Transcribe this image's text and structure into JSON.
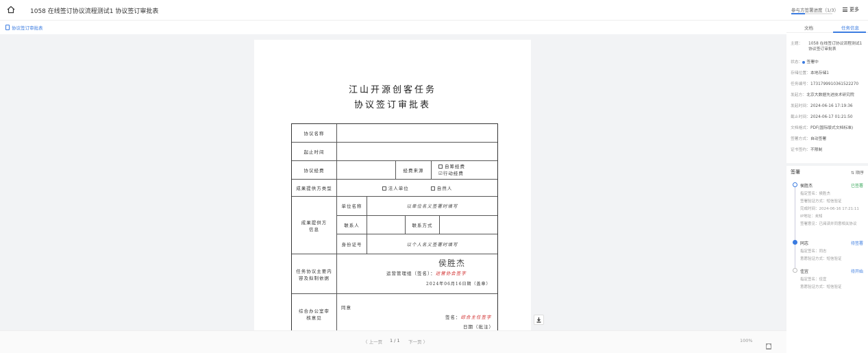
{
  "header": {
    "title": "1058 在线签订协议流程测试1 协议签订审批表",
    "sign_status": "参与方签署进度（1/3）",
    "sign_progress": 0.33,
    "more_label": "更多"
  },
  "doc_tab": {
    "label": "协议签订审批表"
  },
  "document": {
    "title_line1": "江山开源创客任务",
    "title_line2": "协议签订审批表",
    "rows": {
      "agreement_name": "协议名称",
      "period": "起止时间",
      "funds": "协议经费",
      "funds_source": "经费来源",
      "self_funds": "自筹经费",
      "action_funds": "行动经费",
      "provider_type": "成果提供方类型",
      "legal_entity": "法人单位",
      "natural_person": "自然人",
      "provider_info": "成果提供方信息",
      "unit_name": "单位名称",
      "unit_name_hint": "以单位名义签署时填写",
      "contact": "联系人",
      "contact_method": "联系方式",
      "id_number": "身份证号",
      "id_hint": "以个人名义签署时填写",
      "main_content": "任务协议主要内容及拟制依据",
      "manager_sign": "运营管理组（签名）：",
      "manager_sign_red": "运营协会签字",
      "manager_hand": "侯胜杰",
      "manager_date": "2024年06月16日期（盖章）",
      "office_opinion": "综合办公室审核意见",
      "agree": "同意",
      "sign_label": "签名：",
      "sign_red": "综合主任签字",
      "date_label": "日期（批注）"
    }
  },
  "pager": {
    "prev": "〈 上一页",
    "page": "1 / 1",
    "next": "下一页 〉",
    "zoom": "100%"
  },
  "side_tabs": {
    "file": "文档",
    "task": "任务信息"
  },
  "info": {
    "topic_k": "主题：",
    "topic_v": "1058 在线签订协议流程测试1 协议签订审批表",
    "status_k": "状态：",
    "status_v": "签署中",
    "storage_k": "存储位置：",
    "storage_v": "本地存储1",
    "code_k": "任务编号：",
    "code_v": "1731799910361522270",
    "sender_k": "发起方：",
    "sender_v": "北京大数据先进技术研究院",
    "start_k": "发起时间：",
    "start_v": "2024-06-16 17:19:36",
    "deadline_k": "截止时间：",
    "deadline_v": "2024-06-17 01:21:50",
    "format_k": "文档格式：",
    "format_v": "PDF(国际版式文档标准)",
    "sign_mode_k": "签署方式：",
    "sign_mode_v": "自动签署",
    "cert_k": "证书签约：",
    "cert_v": "不限制"
  },
  "signers": {
    "heading": "签署",
    "order_label": "顺序",
    "list": [
      {
        "name": "侯胜杰",
        "state": "已签署",
        "state_color": "#3aa85b",
        "lines": [
          "指定签名：侯胜杰",
          "签署验证方式：短信验证",
          "完成时间：2024-06-16 17:21:11",
          "IP地址：未知",
          "签署意见：已阅读并同意相关协议"
        ]
      },
      {
        "name": "同志",
        "state": "待签署",
        "state_color": "#3a7be0",
        "lines": [
          "指定签名：同志",
          "意愿验证方式：短信验证"
        ]
      },
      {
        "name": "佳宜",
        "state": "待开始",
        "state_color": "#3a7be0",
        "lines": [
          "指定签名：佳宜",
          "意愿验证方式：短信验证"
        ]
      }
    ]
  }
}
